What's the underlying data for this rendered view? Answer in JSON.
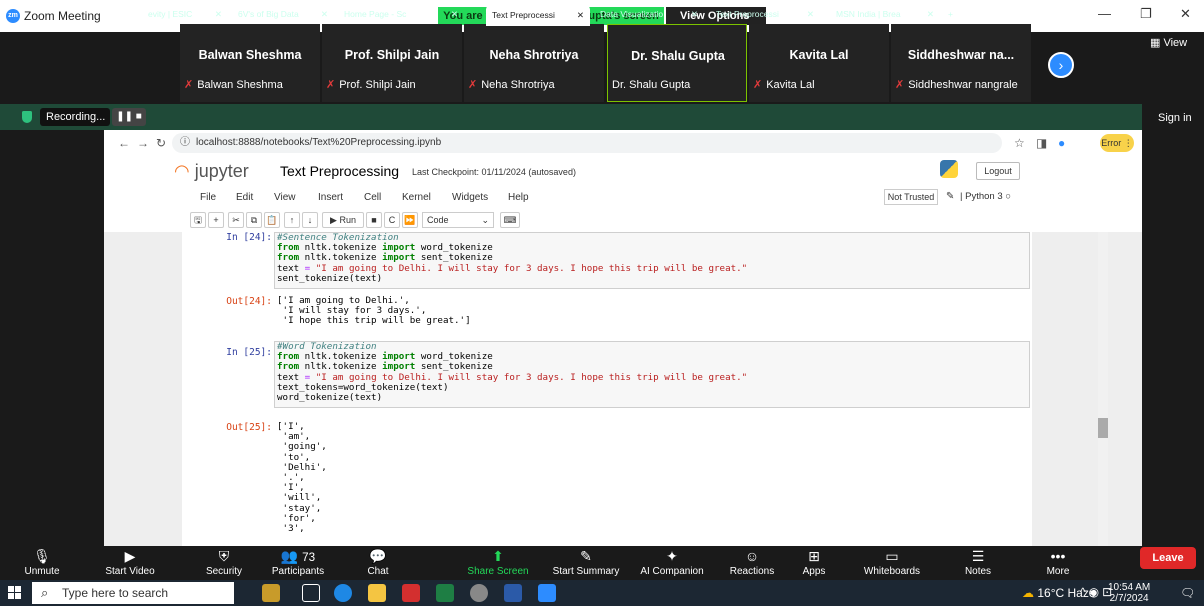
{
  "zoom": {
    "window_title": "Zoom Meeting",
    "logo_text": "zm",
    "share_banner": "You are viewing Dr. Shalu Gupta's screen",
    "view_options": "View Options",
    "view_button": "View",
    "participants": [
      {
        "name": "Balwan Sheshma",
        "label": "Balwan Sheshma",
        "muted": true
      },
      {
        "name": "Prof. Shilpi Jain",
        "label": "Prof. Shilpi Jain",
        "muted": true
      },
      {
        "name": "Neha Shrotriya",
        "label": "Neha Shrotriya",
        "muted": true
      },
      {
        "name": "Dr. Shalu Gupta",
        "label": "Dr. Shalu Gupta",
        "muted": false,
        "active": true
      },
      {
        "name": "Kavita Lal",
        "label": "Kavita Lal",
        "muted": true
      },
      {
        "name": "Siddheshwar  na...",
        "label": "Siddheshwar nangrale",
        "muted": true
      }
    ],
    "controls": [
      {
        "label": "Unmute",
        "icon": "mic-off-icon"
      },
      {
        "label": "Start Video",
        "icon": "video-off-icon"
      },
      {
        "label": "Security",
        "icon": "shield-icon"
      },
      {
        "label": "Participants",
        "icon": "participants-icon",
        "count": "73"
      },
      {
        "label": "Chat",
        "icon": "chat-icon"
      },
      {
        "label": "Share Screen",
        "icon": "share-screen-icon"
      },
      {
        "label": "Start Summary",
        "icon": "summary-icon"
      },
      {
        "label": "AI Companion",
        "icon": "ai-companion-icon"
      },
      {
        "label": "Reactions",
        "icon": "reactions-icon"
      },
      {
        "label": "Apps",
        "icon": "apps-icon"
      },
      {
        "label": "Whiteboards",
        "icon": "whiteboard-icon"
      },
      {
        "label": "Notes",
        "icon": "notes-icon"
      },
      {
        "label": "More",
        "icon": "more-icon"
      }
    ],
    "leave": "Leave",
    "sign_in": "Sign in",
    "share_screen_color": "#23d959",
    "leave_color": "#e02828"
  },
  "browser": {
    "recording": "Recording...",
    "tabs": [
      {
        "label": "evity | ESIC"
      },
      {
        "label": "6V's of Big Data"
      },
      {
        "label": "Home Page - Sc"
      },
      {
        "label": "Text Preprocessi",
        "active": true
      },
      {
        "label": "Data Visualizatio"
      },
      {
        "label": "Text Preprocessi"
      },
      {
        "label": "MSN India | Brea"
      }
    ],
    "url": "localhost:8888/notebooks/Text%20Preprocessing.ipynb",
    "error_chip": "Error"
  },
  "jupyter": {
    "logo": "jupyter",
    "title": "Text Preprocessing",
    "checkpoint": "Last Checkpoint: 01/11/2024  (autosaved)",
    "logout": "Logout",
    "menu": [
      "File",
      "Edit",
      "View",
      "Insert",
      "Cell",
      "Kernel",
      "Widgets",
      "Help"
    ],
    "not_trusted": "Not Trusted",
    "kernel": "Python 3",
    "run": "Run",
    "cell_type": "Code",
    "cells": [
      {
        "in_prompt": "In [24]:",
        "lines": [
          "#Sentence Tokenization",
          "from nltk.tokenize import word_tokenize",
          "from nltk.tokenize import sent_tokenize",
          "text = \"I am going to Delhi. I will stay for 3 days. I hope this trip will be great.\"",
          "sent_tokenize(text)"
        ],
        "out_prompt": "Out[24]:",
        "output": [
          "['I am going to Delhi.',",
          " 'I will stay for 3 days.',",
          " 'I hope this trip will be great.']"
        ]
      },
      {
        "in_prompt": "In [25]:",
        "lines": [
          "#Word Tokenization",
          "from nltk.tokenize import word_tokenize",
          "from nltk.tokenize import sent_tokenize",
          "text = \"I am going to Delhi. I will stay for 3 days. I hope this trip will be great.\"",
          "text_tokens=word_tokenize(text)",
          "word_tokenize(text)"
        ],
        "out_prompt": "Out[25]:",
        "output": [
          "['I',",
          " 'am',",
          " 'going',",
          " 'to',",
          " 'Delhi',",
          " '.',",
          " 'I',",
          " 'will',",
          " 'stay',",
          " 'for',",
          " '3',"
        ]
      }
    ]
  },
  "taskbar": {
    "search_placeholder": "Type here to search",
    "weather": "16°C  Haze",
    "time": "10:54 AM",
    "date": "2/7/2024"
  }
}
